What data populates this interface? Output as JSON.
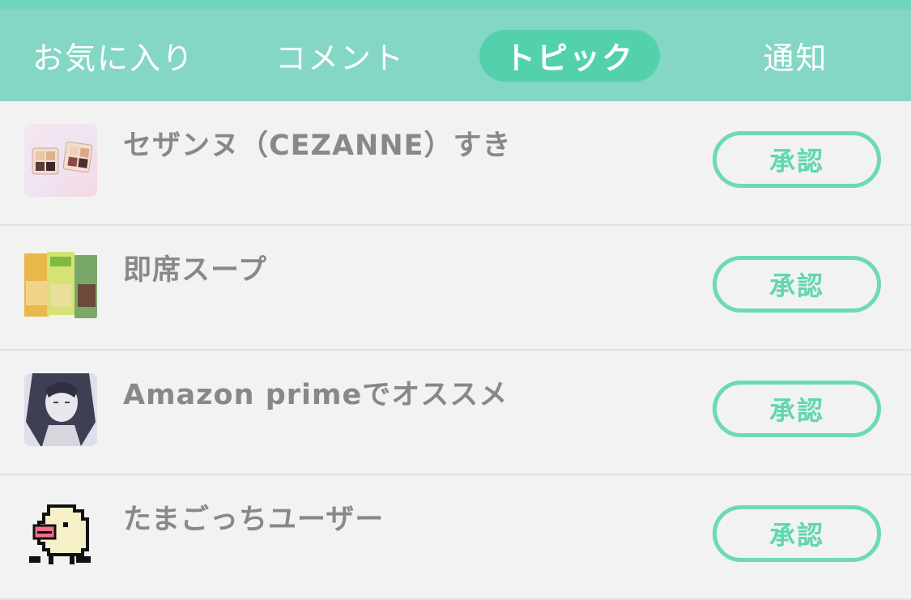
{
  "tabs": [
    {
      "label": "お気に入り",
      "active": false
    },
    {
      "label": "コメント",
      "active": false
    },
    {
      "label": "トピック",
      "active": true
    },
    {
      "label": "通知",
      "active": false
    }
  ],
  "colors": {
    "header_bg": "#84d7c4",
    "active_pill": "#53d1ad",
    "accent": "#62d6b0"
  },
  "topics": [
    {
      "title": "セザンヌ（CEZANNE）すき",
      "thumbnail": "eyeshadow-palette-image",
      "action_label": "承認"
    },
    {
      "title": "即席スープ",
      "thumbnail": "soup-packets-image",
      "action_label": "承認"
    },
    {
      "title": "Amazon primeでオススメ",
      "thumbnail": "anime-character-image",
      "action_label": "承認"
    },
    {
      "title": "たまごっちユーザー",
      "thumbnail": "pixel-character-image",
      "action_label": "承認"
    }
  ]
}
